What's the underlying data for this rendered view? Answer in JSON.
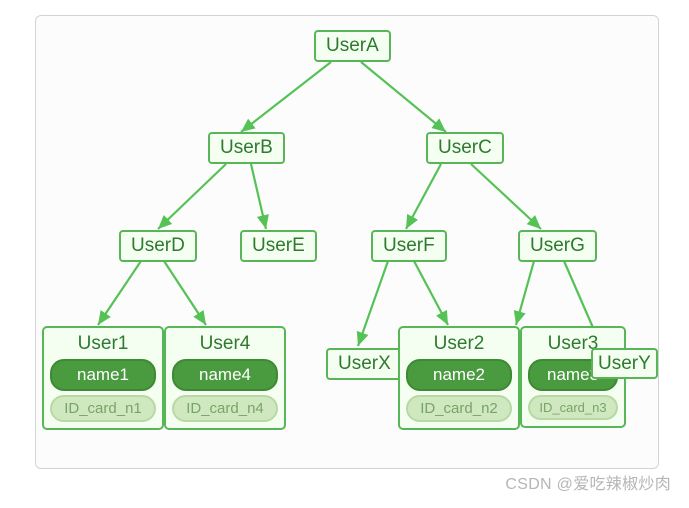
{
  "diagram": {
    "type": "tree",
    "root": "UserA",
    "edges": [
      [
        "UserA",
        "UserB"
      ],
      [
        "UserA",
        "UserC"
      ],
      [
        "UserB",
        "UserD"
      ],
      [
        "UserB",
        "UserE"
      ],
      [
        "UserC",
        "UserF"
      ],
      [
        "UserC",
        "UserG"
      ],
      [
        "UserD",
        "User1"
      ],
      [
        "UserD",
        "User4"
      ],
      [
        "UserF",
        "UserX"
      ],
      [
        "UserF",
        "User2"
      ],
      [
        "UserG",
        "User3"
      ],
      [
        "UserG",
        "UserY"
      ]
    ],
    "nodes": {
      "UserA": {
        "label": "UserA"
      },
      "UserB": {
        "label": "UserB"
      },
      "UserC": {
        "label": "UserC"
      },
      "UserD": {
        "label": "UserD"
      },
      "UserE": {
        "label": "UserE"
      },
      "UserF": {
        "label": "UserF"
      },
      "UserG": {
        "label": "UserG"
      },
      "UserX": {
        "label": "UserX"
      },
      "UserY": {
        "label": "UserY"
      },
      "User1": {
        "label": "User1",
        "name": "name1",
        "id_card": "ID_card_n1"
      },
      "User4": {
        "label": "User4",
        "name": "name4",
        "id_card": "ID_card_n4"
      },
      "User2": {
        "label": "User2",
        "name": "name2",
        "id_card": "ID_card_n2"
      },
      "User3": {
        "label": "User3",
        "name": "name3",
        "id_card": "ID_card_n3"
      }
    }
  },
  "colors": {
    "border": "#58b658",
    "node_bg": "#f4fff2",
    "name_pill": "#4a9a3f",
    "id_pill": "#cfe8bf",
    "edge": "#55c255"
  },
  "watermark": "CSDN @爱吃辣椒炒肉"
}
